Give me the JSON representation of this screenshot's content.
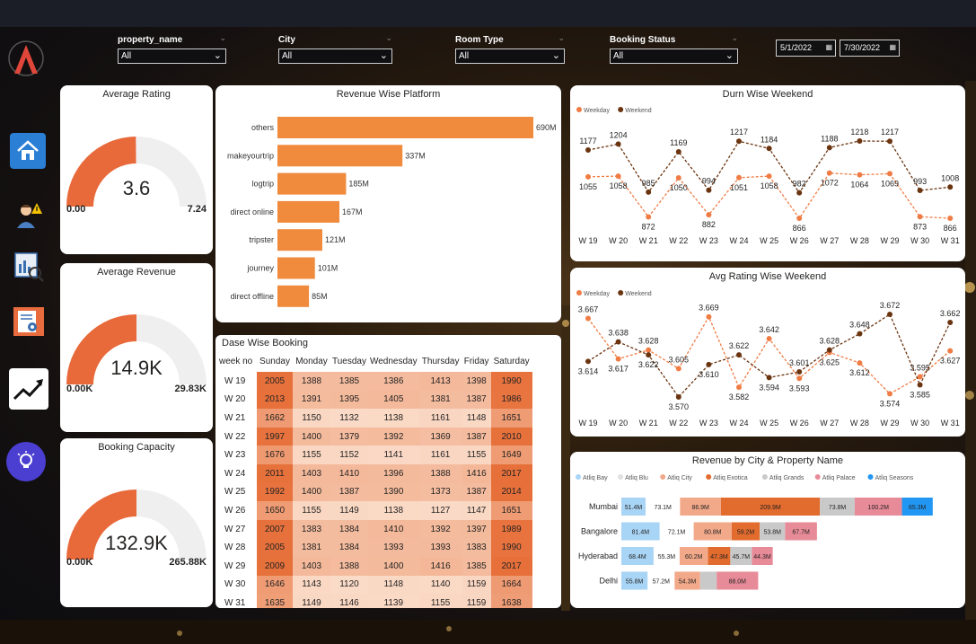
{
  "filters": {
    "property_name": {
      "label": "property_name",
      "value": "All"
    },
    "city": {
      "label": "City",
      "value": "All"
    },
    "room_type": {
      "label": "Room Type",
      "value": "All"
    },
    "booking_status": {
      "label": "Booking Status",
      "value": "All"
    },
    "date_start": "5/1/2022",
    "date_end": "7/30/2022"
  },
  "nav": {
    "items": [
      "home-icon",
      "user-alert-icon",
      "report-search-icon",
      "document-gear-icon",
      "trend-up-icon",
      "idea-icon"
    ]
  },
  "gauges": [
    {
      "title": "Average Rating",
      "value": "3.6",
      "min": "0.00",
      "max": "7.24",
      "fraction": 0.497
    },
    {
      "title": "Average Revenue",
      "value": "14.9K",
      "min": "0.00K",
      "max": "29.83K",
      "fraction": 0.5
    },
    {
      "title": "Booking Capacity",
      "value": "132.9K",
      "min": "0.00K",
      "max": "265.88K",
      "fraction": 0.5
    }
  ],
  "platform_chart": {
    "title": "Revenue Wise Platform",
    "chart_data": {
      "type": "bar",
      "orientation": "horizontal",
      "title": "Revenue Wise Platform",
      "categories": [
        "others",
        "makeyourtrip",
        "logtrip",
        "direct online",
        "tripster",
        "journey",
        "direct offline"
      ],
      "values": [
        690,
        337,
        185,
        167,
        121,
        101,
        85
      ],
      "labels": [
        "690M",
        "337M",
        "185M",
        "167M",
        "121M",
        "101M",
        "85M"
      ],
      "color": "#f08a3c"
    }
  },
  "durn_chart": {
    "title": "Durn Wise Weekend",
    "chart_data": {
      "type": "line",
      "title": "Durn Wise Weekend",
      "categories": [
        "W 19",
        "W 20",
        "W 21",
        "W 22",
        "W 23",
        "W 24",
        "W 25",
        "W 26",
        "W 27",
        "W 28",
        "W 29",
        "W 30",
        "W 31"
      ],
      "series": [
        {
          "name": "Weekday",
          "color": "#f07c45",
          "values": [
            1055,
            1058,
            872,
            1050,
            882,
            1051,
            1058,
            866,
            1072,
            1064,
            1069,
            873,
            866
          ]
        },
        {
          "name": "Weekend",
          "color": "#6b3410",
          "values": [
            1177,
            1204,
            985,
            1169,
            994,
            1217,
            1184,
            982,
            1188,
            1218,
            1217,
            993,
            1008
          ]
        }
      ],
      "legend": "top-left"
    }
  },
  "rating_chart": {
    "title": "Avg Rating Wise Weekend",
    "chart_data": {
      "type": "line",
      "title": "Avg Rating Wise Weekend",
      "categories": [
        "W 19",
        "W 20",
        "W 21",
        "W 22",
        "W 23",
        "W 24",
        "W 25",
        "W 26",
        "W 27",
        "W 28",
        "W 29",
        "W 30",
        "W 31"
      ],
      "series": [
        {
          "name": "Weekday",
          "color": "#f07c45",
          "values": [
            3.667,
            3.617,
            3.628,
            3.605,
            3.669,
            3.582,
            3.642,
            3.593,
            3.625,
            3.612,
            3.574,
            3.595,
            3.627
          ]
        },
        {
          "name": "Weekend",
          "color": "#6b3410",
          "values": [
            3.614,
            3.638,
            3.622,
            3.57,
            3.61,
            3.622,
            3.594,
            3.601,
            3.628,
            3.648,
            3.672,
            3.585,
            3.662
          ]
        }
      ],
      "legend": "top-left"
    }
  },
  "booking_table": {
    "title": "Dase Wise Booking",
    "columns": [
      "week no",
      "Sunday",
      "Monday",
      "Tuesday",
      "Wednesday",
      "Thursday",
      "Friday",
      "Saturday"
    ],
    "rows": [
      [
        "W 19",
        2005,
        1388,
        1385,
        1386,
        1413,
        1398,
        1990
      ],
      [
        "W 20",
        2013,
        1391,
        1395,
        1405,
        1381,
        1387,
        1986
      ],
      [
        "W 21",
        1662,
        1150,
        1132,
        1138,
        1161,
        1148,
        1651
      ],
      [
        "W 22",
        1997,
        1400,
        1379,
        1392,
        1369,
        1387,
        2010
      ],
      [
        "W 23",
        1676,
        1155,
        1152,
        1141,
        1161,
        1155,
        1649
      ],
      [
        "W 24",
        2011,
        1403,
        1410,
        1396,
        1388,
        1416,
        2017
      ],
      [
        "W 25",
        1992,
        1400,
        1387,
        1390,
        1373,
        1387,
        2014
      ],
      [
        "W 26",
        1650,
        1155,
        1149,
        1138,
        1127,
        1147,
        1651
      ],
      [
        "W 27",
        2007,
        1383,
        1384,
        1410,
        1392,
        1397,
        1989
      ],
      [
        "W 28",
        2005,
        1381,
        1384,
        1393,
        1393,
        1383,
        1990
      ],
      [
        "W 29",
        2009,
        1403,
        1388,
        1400,
        1416,
        1385,
        2017
      ],
      [
        "W 30",
        1646,
        1143,
        1120,
        1148,
        1140,
        1159,
        1664
      ],
      [
        "W 31",
        1635,
        1149,
        1146,
        1139,
        1155,
        1159,
        1638
      ]
    ]
  },
  "city_chart": {
    "title": "Revenue by City & Property Name",
    "chart_data": {
      "type": "bar",
      "stacked": true,
      "orientation": "horizontal",
      "title": "Revenue by City & Property Name",
      "categories": [
        "Mumbai",
        "Bangalore",
        "Hyderabad",
        "Delhi"
      ],
      "series": [
        {
          "name": "Atliq Bay",
          "color": "#a8d4f5",
          "values": [
            51.4,
            81.4,
            68.4,
            55.8
          ],
          "labels": [
            "51.4M",
            "81.4M",
            "68.4M",
            "55.8M"
          ]
        },
        {
          "name": "Atliq Blu",
          "color": "#ffffff",
          "values": [
            73.1,
            72.1,
            55.3,
            57.2
          ],
          "labels": [
            "73.1M",
            "72.1M",
            "55.3M",
            "57.2M"
          ]
        },
        {
          "name": "Atliq City",
          "color": "#f2a98a",
          "values": [
            86.9,
            80.8,
            60.2,
            54.3
          ],
          "labels": [
            "86.9M",
            "80.8M",
            "60.2M",
            "54.3M"
          ]
        },
        {
          "name": "Atliq Exotica",
          "color": "#e26b2e",
          "values": [
            209.9,
            59.2,
            47.3,
            0
          ],
          "labels": [
            "209.9M",
            "59.2M",
            "47.3M",
            ""
          ]
        },
        {
          "name": "Atliq Grands",
          "color": "#c9c9c9",
          "values": [
            73.8,
            53.8,
            45.7,
            35
          ],
          "labels": [
            "73.8M",
            "53.8M",
            "45.7M",
            ""
          ]
        },
        {
          "name": "Atliq Palace",
          "color": "#e88b98",
          "values": [
            100.2,
            67.7,
            44.3,
            88.0
          ],
          "labels": [
            "100.2M",
            "67.7M",
            "44.3M",
            "88.0M"
          ]
        },
        {
          "name": "Atliq Seasons",
          "color": "#2196f3",
          "values": [
            65.3,
            0,
            0,
            0
          ],
          "labels": [
            "65.3M",
            "",
            "",
            ""
          ]
        }
      ],
      "legend": "top"
    }
  }
}
